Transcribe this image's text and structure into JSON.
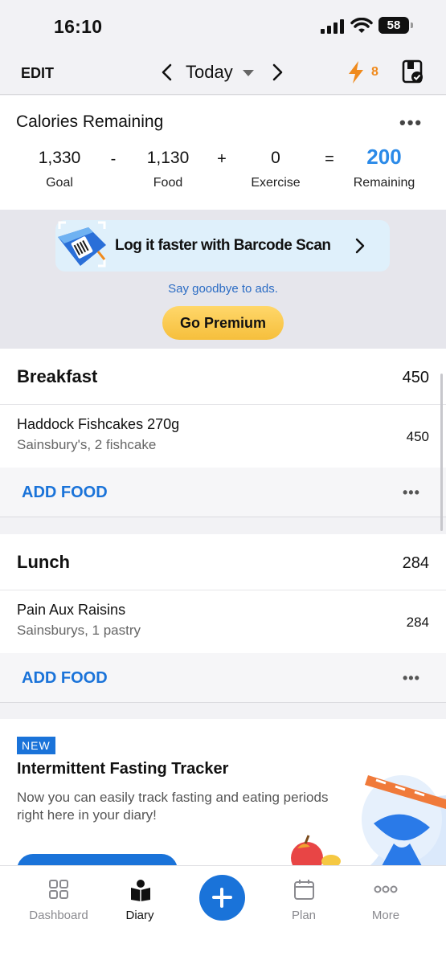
{
  "status_bar": {
    "time": "16:10",
    "battery": "58"
  },
  "nav": {
    "edit_label": "EDIT",
    "date_label": "Today",
    "streak_count": "8"
  },
  "calories": {
    "title": "Calories Remaining",
    "goal_value": "1,330",
    "goal_label": "Goal",
    "minus": "-",
    "food_value": "1,130",
    "food_label": "Food",
    "plus": "+",
    "exercise_value": "0",
    "exercise_label": "Exercise",
    "equals": "=",
    "remaining_value": "200",
    "remaining_label": "Remaining",
    "more": "•••"
  },
  "promo": {
    "banner_text": "Log it faster with Barcode Scan",
    "ads_text": "Say goodbye to ads.",
    "premium_label": "Go Premium"
  },
  "meals": [
    {
      "title": "Breakfast",
      "calories": "450",
      "entries": [
        {
          "name": "Haddock Fishcakes 270g",
          "detail": "Sainsbury's, 2 fishcake",
          "calories": "450"
        }
      ],
      "add_label": "ADD FOOD",
      "more": "•••"
    },
    {
      "title": "Lunch",
      "calories": "284",
      "entries": [
        {
          "name": "Pain Aux Raisins",
          "detail": "Sainsburys, 1 pastry",
          "calories": "284"
        }
      ],
      "add_label": "ADD FOOD",
      "more": "•••"
    }
  ],
  "fasting": {
    "badge": "NEW",
    "title": "Intermittent Fasting Tracker",
    "description": "Now you can easily track fasting and eating periods right here in your diary!"
  },
  "tabs": [
    {
      "label": "Dashboard",
      "icon": "dashboard-grid-icon",
      "active": false
    },
    {
      "label": "Diary",
      "icon": "diary-book-icon",
      "active": true
    },
    {
      "label": "Plan",
      "icon": "calendar-icon",
      "active": false
    },
    {
      "label": "More",
      "icon": "more-dots-icon",
      "active": false
    }
  ],
  "colors": {
    "accent": "#1a73d9",
    "remaining": "#2b8ae8",
    "streak": "#f08a1c",
    "premium": "#f6bf3c"
  }
}
